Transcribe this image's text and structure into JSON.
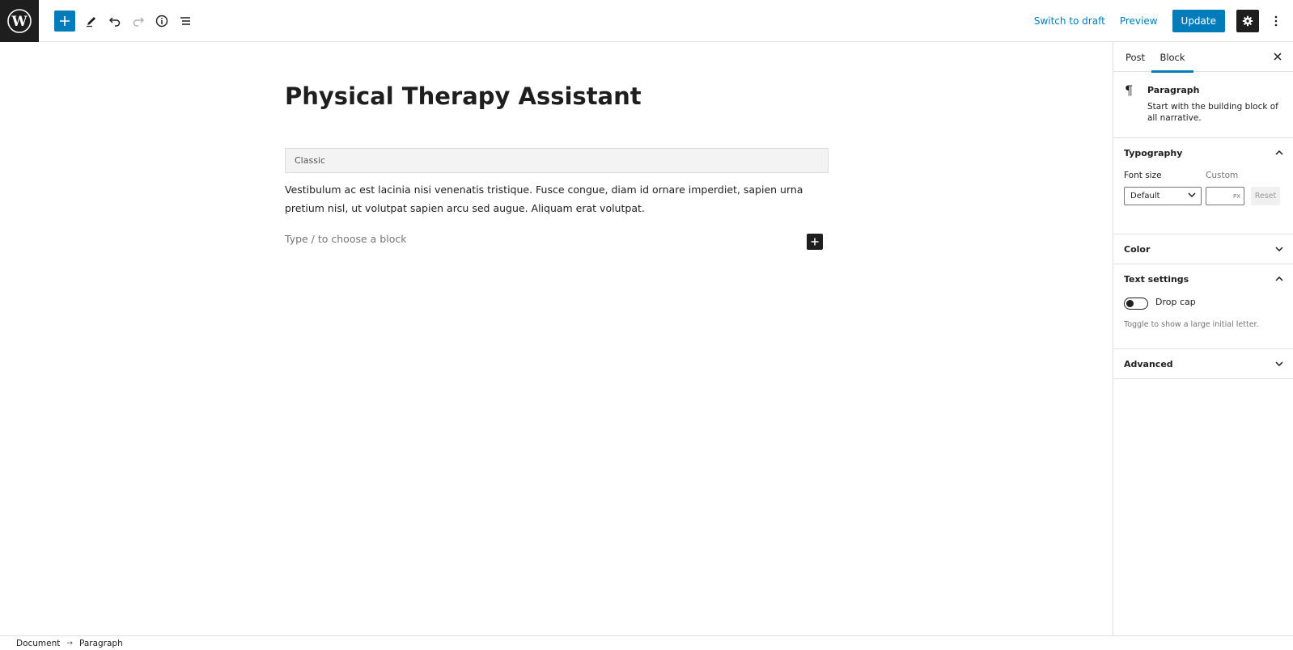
{
  "toolbar": {
    "switch_to_draft": "Switch to draft",
    "preview": "Preview",
    "update": "Update"
  },
  "editor": {
    "title": "Physical Therapy Assistant",
    "classic_label": "Classic",
    "paragraph": "Vestibulum ac est lacinia nisi venenatis tristique. Fusce congue, diam id ornare imperdiet, sapien urna pretium nisl, ut volutpat sapien arcu sed augue. Aliquam erat volutpat.",
    "placeholder": "Type / to choose a block"
  },
  "sidebar": {
    "tabs": [
      "Post",
      "Block"
    ],
    "active_tab": "Block",
    "block": {
      "name": "Paragraph",
      "description": "Start with the building block of all narrative."
    },
    "typography": {
      "title": "Typography",
      "font_size_label": "Font size",
      "custom_label": "Custom",
      "select_value": "Default",
      "unit": "PX",
      "reset": "Reset"
    },
    "color": {
      "title": "Color"
    },
    "text_settings": {
      "title": "Text settings",
      "drop_cap_label": "Drop cap",
      "drop_cap_help": "Toggle to show a large initial letter."
    },
    "advanced": {
      "title": "Advanced"
    }
  },
  "footer": {
    "crumbs": [
      "Document",
      "Paragraph"
    ]
  },
  "colors": {
    "accent": "#007cba",
    "dark": "#1e1e1e",
    "top_border": "#6b46c1"
  }
}
